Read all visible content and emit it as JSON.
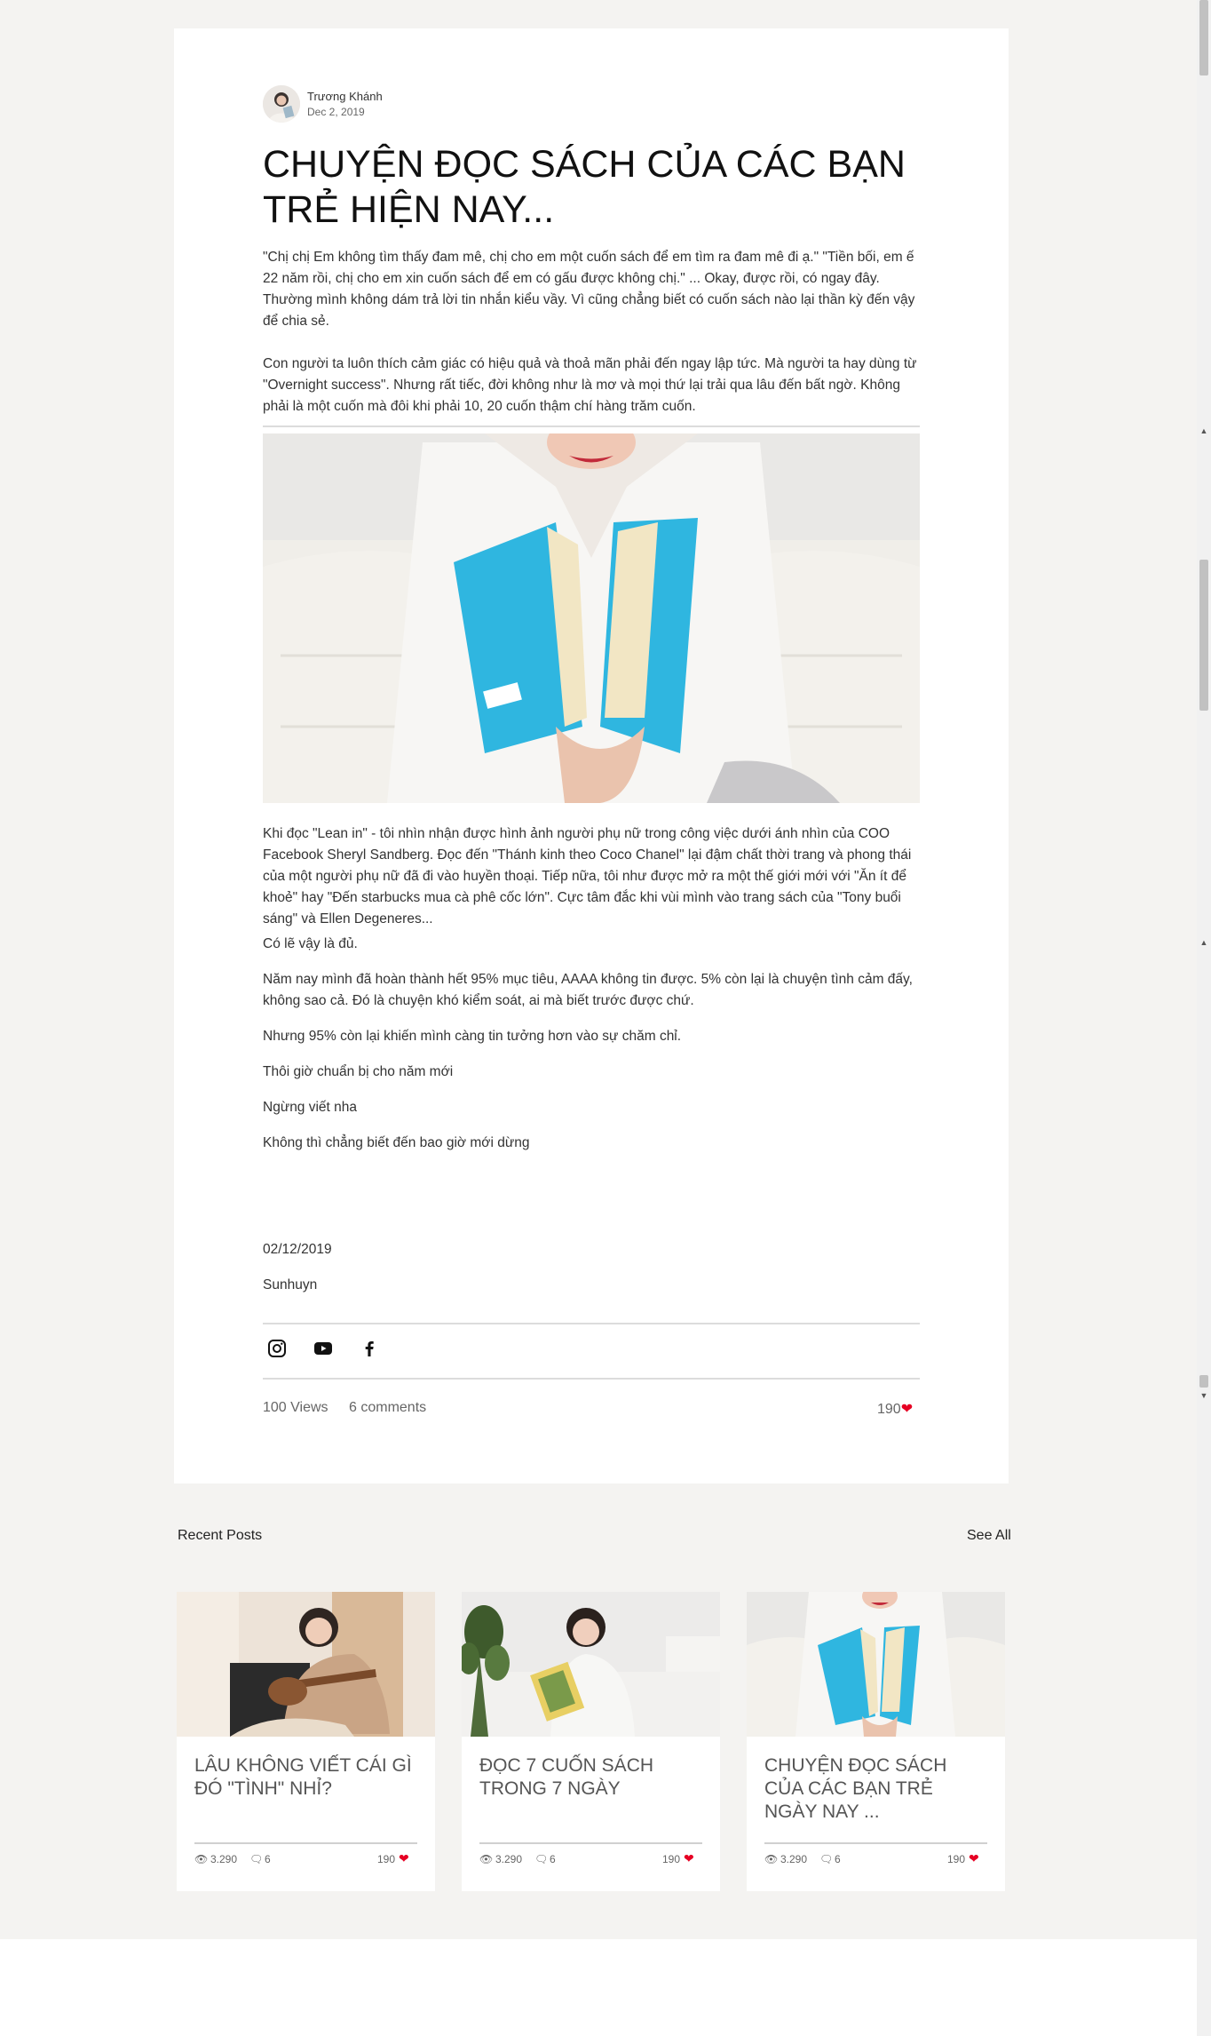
{
  "post": {
    "author": "Trương Khánh",
    "date": "Dec 2, 2019",
    "title": "CHUYỆN ĐỌC SÁCH CỦA CÁC BẠN TRẺ HIỆN NAY...",
    "para1": "\"Chị chị Em không tìm thấy đam mê, chị cho em một cuốn sách để em tìm ra đam mê đi ạ.\" \"Tiền bối, em ế 22 năm rồi, chị cho em xin cuốn sách để em có gấu được không chị.\" ... Okay, được rồi, có ngay đây. Thường mình không dám trả lời tin nhắn kiểu vầy. Vì cũng chẳng biết có cuốn sách nào lại thần kỳ đến vậy để chia sẻ.",
    "para2": "Con người ta luôn thích cảm giác có hiệu quả và thoả mãn phải đến ngay lập tức. Mà người ta hay dùng từ \"Overnight success\". Nhưng rất tiếc, đời không như là mơ và mọi thứ lại trải qua lâu đến bất ngờ. Không phải là một cuốn mà đôi khi phải 10, 20 cuốn thậm chí hàng trăm cuốn.",
    "para3": "Khi đọc \"Lean in\" - tôi nhìn nhận được hình ảnh người phụ nữ trong công việc dưới ánh nhìn của COO Facebook Sheryl Sandberg. Đọc đến \"Thánh kinh theo Coco Chanel\" lại đậm chất thời trang và phong thái của một người phụ nữ đã đi vào huyền thoại. Tiếp nữa, tôi như được mở ra một thế giới mới với \"Ăn ít để khoẻ\" hay \"Đến starbucks mua cà phê cốc lớn\". Cực tâm đắc khi vùi mình vào trang sách của \"Tony buổi sáng\" và Ellen Degeneres...",
    "para4": "Có lẽ vậy là đủ.",
    "para5": "Năm nay mình đã hoàn thành hết 95% mục tiêu, AAAA không tin được. 5% còn lại là chuyện tình cảm đấy, không sao cả. Đó là chuyện khó kiểm soát, ai mà biết trước được chứ.",
    "para6": "Nhưng 95% còn lại khiến mình càng tin tưởng hơn vào sự chăm chỉ.",
    "para7": "Thôi giờ chuẩn bị cho năm mới",
    "para8": "Ngừng viết nha",
    "para9": "Không thì chẳng biết đến bao giờ mới dừng",
    "sign_date": "02/12/2019",
    "sign_name": "Sunhuyn",
    "views": "100 Views",
    "comments": "6 comments",
    "likes": "190"
  },
  "social_icons": [
    "instagram-icon",
    "youtube-icon",
    "facebook-icon"
  ],
  "recent": {
    "label": "Recent Posts",
    "see_all": "See All",
    "posts": [
      {
        "title": "LÂU KHÔNG VIẾT CÁI GÌ ĐÓ \"TÌNH\" NHỈ?",
        "views": "3.290",
        "comments": "6",
        "likes": "190"
      },
      {
        "title": "ĐỌC 7 CUỐN SÁCH TRONG 7 NGÀY",
        "views": "3.290",
        "comments": "6",
        "likes": "190"
      },
      {
        "title": "CHUYỆN ĐỌC SÁCH CỦA CÁC BẠN TRẺ NGÀY NAY ...",
        "views": "3.290",
        "comments": "6",
        "likes": "190"
      }
    ]
  },
  "colors": {
    "heart": "#e60023",
    "book": "#2fb6e0",
    "page_bg": "#f4f3f1"
  }
}
